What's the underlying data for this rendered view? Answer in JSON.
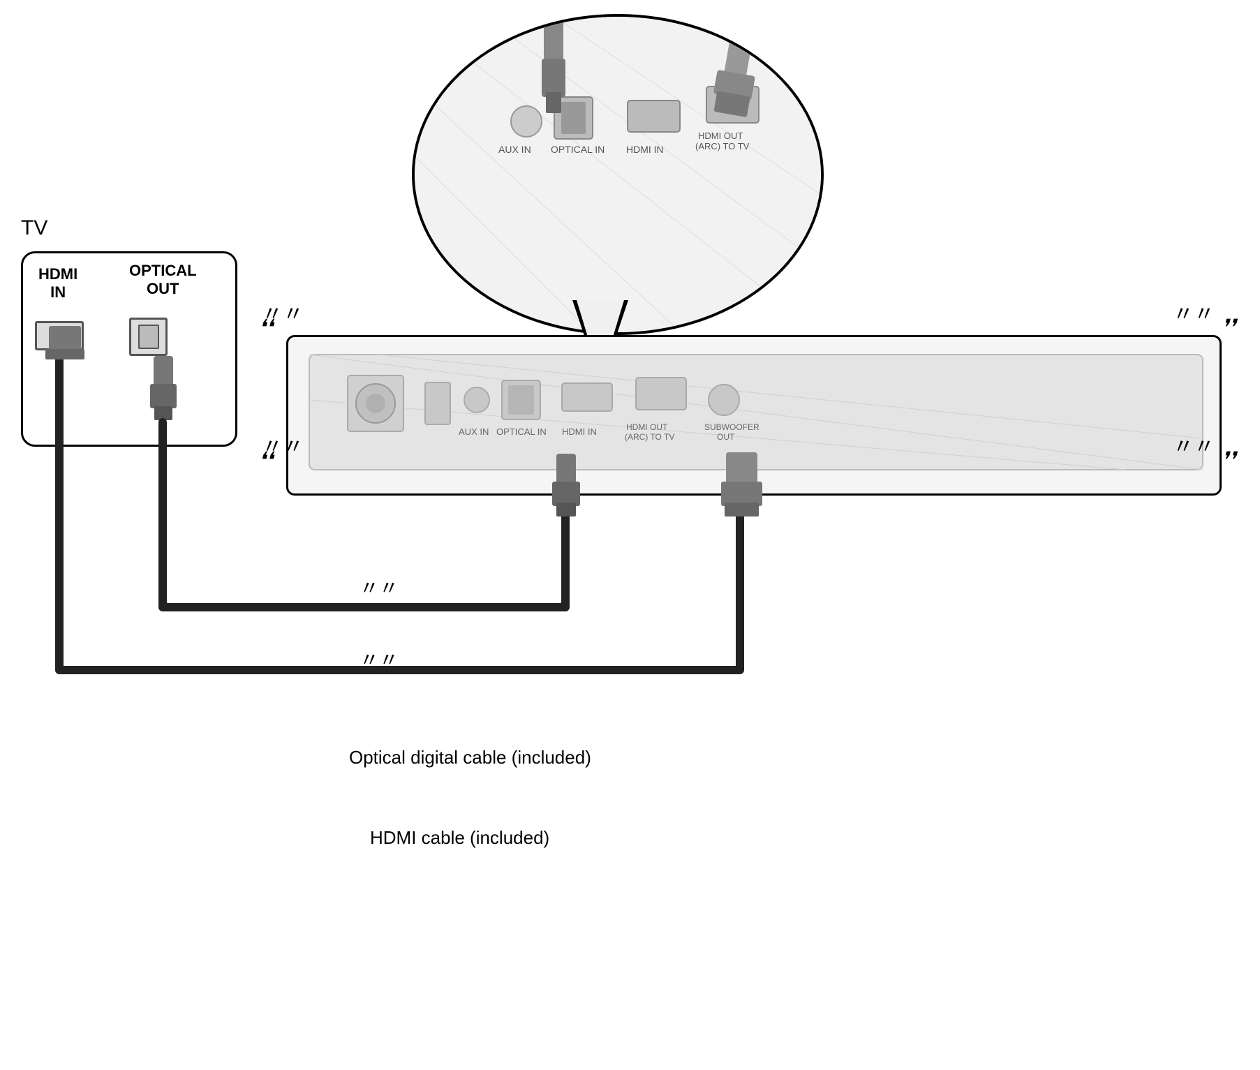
{
  "tv": {
    "label": "TV",
    "hdmi_in_label": "HDMI\nIN",
    "optical_out_label": "OPTICAL\nOUT"
  },
  "soundbar": {
    "ports": {
      "aux_in_label": "AUX IN",
      "optical_in_label": "OPTICAL IN",
      "hdmi_in_label": "HDMI IN",
      "hdmi_out_label": "HDMI OUT\n(ARC) TO TV",
      "subwoofer_label": "SUBWOOFER\nOUT"
    }
  },
  "zoom": {
    "aux_in": "AUX IN",
    "optical_in": "OPTICAL IN",
    "hdmi_in": "HDMI IN",
    "hdmi_out": "HDMI OUT\n(ARC) TO TV"
  },
  "cables": {
    "optical_label": "Optical digital cable (included)",
    "hdmi_label": "HDMI cable (included)"
  },
  "waves": {
    "left_top": "≪",
    "right_top": "≫",
    "left_bottom": "≪",
    "right_bottom": "≫",
    "optical_break": "〃",
    "hdmi_break": "〃"
  }
}
